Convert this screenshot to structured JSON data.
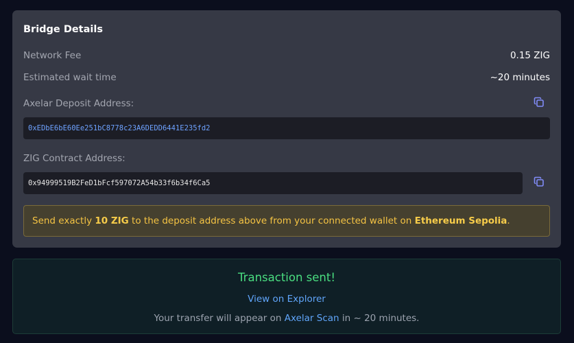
{
  "bridge": {
    "title": "Bridge Details",
    "fee_label": "Network Fee",
    "fee_value": "0.15 ZIG",
    "wait_label": "Estimated wait time",
    "wait_value": "~20 minutes",
    "deposit_label": "Axelar Deposit Address:",
    "deposit_address": "0xEDbE6bE60Ee251bC8778c23A6DEDD6441E235fd2",
    "contract_label": "ZIG Contract Address:",
    "contract_address": "0x94999519B2FeD1bFcf597072A54b33f6b34f6Ca5"
  },
  "warning": {
    "prefix": "Send exactly ",
    "amount": "10 ZIG",
    "middle": " to the deposit address above from your connected wallet on ",
    "network": "Ethereum Sepolia",
    "suffix": "."
  },
  "transaction": {
    "title": "Transaction sent!",
    "explorer_link": "View on Explorer",
    "note_prefix": "Your transfer will appear on ",
    "note_link": "Axelar Scan",
    "note_suffix": " in ~ 20 minutes."
  },
  "icons": {
    "copy": "copy-icon"
  },
  "colors": {
    "accent": "#818cf8",
    "success": "#4ade80",
    "link": "#60a5fa",
    "warning_text": "#f5c343"
  }
}
